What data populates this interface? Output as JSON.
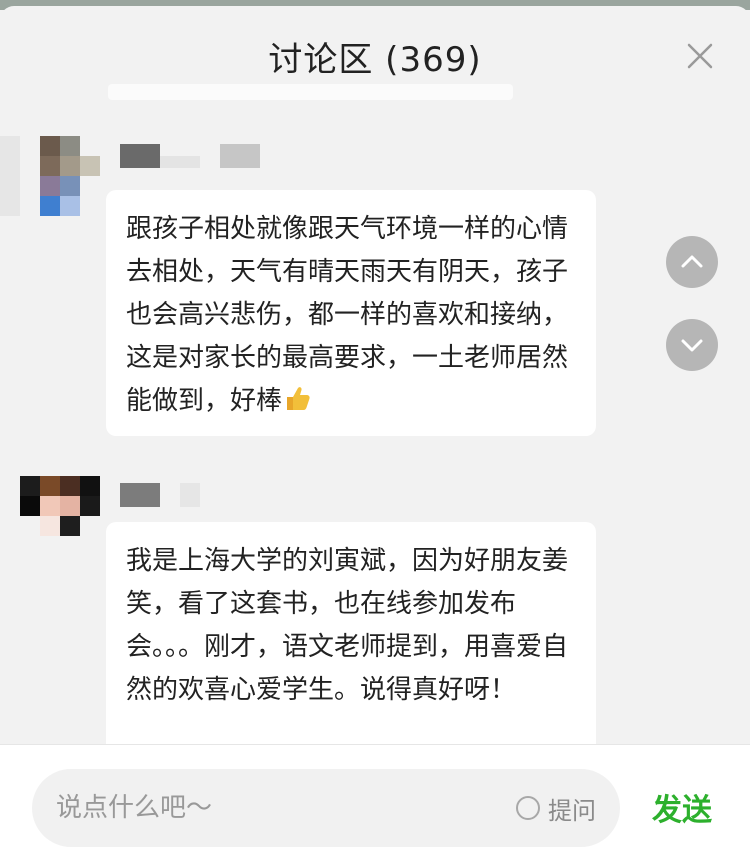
{
  "header": {
    "title": "讨论区 (369)"
  },
  "comments": [
    {
      "text": "跟孩子相处就像跟天气环境一样的心情去相处，天气有晴天雨天有阴天，孩子也会高兴悲伤，都一样的喜欢和接纳，这是对家长的最高要求，一土老师居然能做到，好棒"
    },
    {
      "text": "我是上海大学的刘寅斌，因为好朋友姜笑，看了这套书，也在线参加发布会。。。刚才，语文老师提到，用喜爱自然的欢喜心爱学生。说得真好呀！"
    }
  ],
  "footer": {
    "input_placeholder": "说点什么吧～",
    "ask_label": "提问",
    "send_label": "发送"
  },
  "colors": {
    "accent_green": "#2db02d",
    "nav_button": "#b6b6b6"
  },
  "icons": {
    "close": "close-icon",
    "scroll_up": "chevron-up-icon",
    "scroll_down": "chevron-down-icon",
    "thumbs_up": "thumbs-up-icon"
  }
}
